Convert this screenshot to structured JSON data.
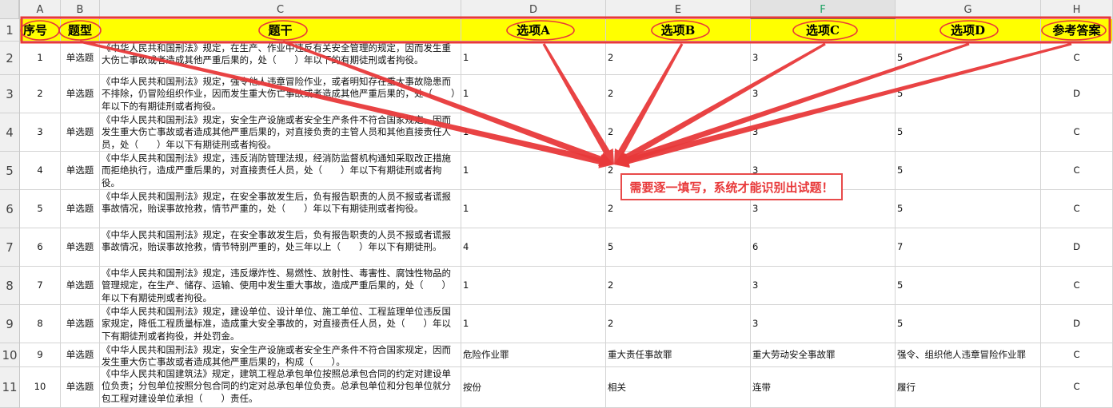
{
  "column_letters": [
    "A",
    "B",
    "C",
    "D",
    "E",
    "F",
    "G",
    "H"
  ],
  "selected_column": "F",
  "row_numbers": [
    "1",
    "2",
    "3",
    "4",
    "5",
    "6",
    "7",
    "8",
    "9",
    "10",
    "11"
  ],
  "header": {
    "seq": "序号",
    "type": "题型",
    "stem": "题干",
    "option_a": "选项A",
    "option_b": "选项B",
    "option_c": "选项C",
    "option_d": "选项D",
    "answer": "参考答案"
  },
  "rows": [
    {
      "seq": "1",
      "type": "单选题",
      "stem": "《中华人民共和国刑法》规定，在生产、作业中违反有关安全管理的规定，因而发生重大伤亡事故或者造成其他严重后果的，处（　　）年以下的有期徒刑或者拘役。",
      "a": "1",
      "b": "2",
      "c": "3",
      "d": "5",
      "answer": "C"
    },
    {
      "seq": "2",
      "type": "单选题",
      "stem": "《中华人民共和国刑法》规定，强令他人违章冒险作业，或者明知存在重大事故隐患而不排除，仍冒险组织作业，因而发生重大伤亡事故或者造成其他严重后果的，处（　　）年以下的有期徒刑或者拘役。",
      "a": "1",
      "b": "2",
      "c": "3",
      "d": "5",
      "answer": "D"
    },
    {
      "seq": "3",
      "type": "单选题",
      "stem": "《中华人民共和国刑法》规定，安全生产设施或者安全生产条件不符合国家规定，因而发生重大伤亡事故或者造成其他严重后果的，对直接负责的主管人员和其他直接责任人员，处（　　）年以下有期徒刑或者拘役。",
      "a": "1",
      "b": "2",
      "c": "3",
      "d": "5",
      "answer": "C"
    },
    {
      "seq": "4",
      "type": "单选题",
      "stem": "《中华人民共和国刑法》规定，违反消防管理法规，经消防监督机构通知采取改正措施而拒绝执行，造成严重后果的，对直接责任人员，处（　　）年以下有期徒刑或者拘役。",
      "a": "1",
      "b": "2",
      "c": "3",
      "d": "5",
      "answer": "C"
    },
    {
      "seq": "5",
      "type": "单选题",
      "stem": "《中华人民共和国刑法》规定，在安全事故发生后，负有报告职责的人员不报或者谎报事故情况，贻误事故抢救，情节严重的，处（　　）年以下有期徒刑或者拘役。",
      "a": "1",
      "b": "2",
      "c": "3",
      "d": "5",
      "answer": "C"
    },
    {
      "seq": "6",
      "type": "单选题",
      "stem": "《中华人民共和国刑法》规定，在安全事故发生后，负有报告职责的人员不报或者谎报事故情况，贻误事故抢救，情节特别严重的，处三年以上（　　）年以下有期徒刑。",
      "a": "4",
      "b": "5",
      "c": "6",
      "d": "7",
      "answer": "D"
    },
    {
      "seq": "7",
      "type": "单选题",
      "stem": "《中华人民共和国刑法》规定，违反爆炸性、易燃性、放射性、毒害性、腐蚀性物品的管理规定，在生产、储存、运输、使用中发生重大事故，造成严重后果的，处（　　）年以下有期徒刑或者拘役。",
      "a": "1",
      "b": "2",
      "c": "3",
      "d": "5",
      "answer": "C"
    },
    {
      "seq": "8",
      "type": "单选题",
      "stem": "《中华人民共和国刑法》规定，建设单位、设计单位、施工单位、工程监理单位违反国家规定，降低工程质量标准，造成重大安全事故的，对直接责任人员，处（　　）年以下有期徒刑或者拘役，并处罚金。",
      "a": "1",
      "b": "2",
      "c": "3",
      "d": "5",
      "answer": "D"
    },
    {
      "seq": "9",
      "type": "单选题",
      "stem": "《中华人民共和国刑法》规定，安全生产设施或者安全生产条件不符合国家规定，因而发生重大伤亡事故或者造成其他严重后果的，构成（　　）。",
      "a": "危险作业罪",
      "b": "重大责任事故罪",
      "c": "重大劳动安全事故罪",
      "d": "强令、组织他人违章冒险作业罪",
      "answer": "C"
    },
    {
      "seq": "10",
      "type": "单选题",
      "stem": "《中华人民共和国建筑法》规定，建筑工程总承包单位按照总承包合同的约定对建设单位负责；分包单位按照分包合同的约定对总承包单位负责。总承包单位和分包单位就分包工程对建设单位承担（　　）责任。",
      "a": "按份",
      "b": "相关",
      "c": "连带",
      "d": "履行",
      "answer": "C"
    }
  ],
  "annotation": {
    "text": "需要逐一填写，系统才能识别出试题！",
    "color": "#e8393a"
  },
  "colors": {
    "header_fill": "#ffff00",
    "highlight": "#e8393a",
    "selected_column": "#21a366"
  }
}
